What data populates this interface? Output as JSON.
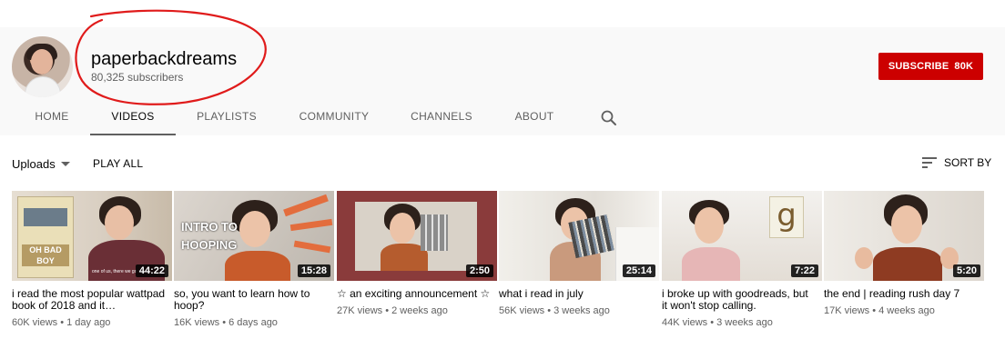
{
  "channel": {
    "name": "paperbackdreams",
    "subscribers": "80,325 subscribers",
    "subscribe_label": "SUBSCRIBE",
    "subscribe_count": "80K"
  },
  "tabs": [
    "HOME",
    "VIDEOS",
    "PLAYLISTS",
    "COMMUNITY",
    "CHANNELS",
    "ABOUT"
  ],
  "active_tab": "VIDEOS",
  "filter": {
    "uploads_label": "Uploads",
    "play_all_label": "PLAY ALL",
    "sort_label": "SORT BY"
  },
  "videos": [
    {
      "title": "i read the most popular wattpad book of 2018 and it…",
      "duration": "44:22",
      "views": "60K views",
      "age": "1 day ago"
    },
    {
      "title": "so, you want to learn how to hoop?",
      "duration": "15:28",
      "views": "16K views",
      "age": "6 days ago"
    },
    {
      "title": "☆ an exciting announcement ☆",
      "duration": "2:50",
      "views": "27K views",
      "age": "2 weeks ago"
    },
    {
      "title": "what i read in july",
      "duration": "25:14",
      "views": "56K views",
      "age": "3 weeks ago"
    },
    {
      "title": "i broke up with goodreads, but it won't stop calling.",
      "duration": "7:22",
      "views": "44K views",
      "age": "3 weeks ago"
    },
    {
      "title": "the end | reading rush day 7",
      "duration": "5:20",
      "views": "17K views",
      "age": "4 weeks ago"
    }
  ],
  "thumb_text": {
    "book_title": "OH BAD BOY",
    "book_caption": "one of us, there we go ag",
    "hoop_line1": "INTRO TO",
    "hoop_line2": "HOOPING",
    "goodreads_letter": "g"
  },
  "colors": {
    "subscribe_red": "#cc0000",
    "annotation_red": "#e01b1b"
  },
  "icons": {
    "search": "search-icon",
    "dropdown": "chevron-down-icon",
    "sort": "sort-icon"
  }
}
